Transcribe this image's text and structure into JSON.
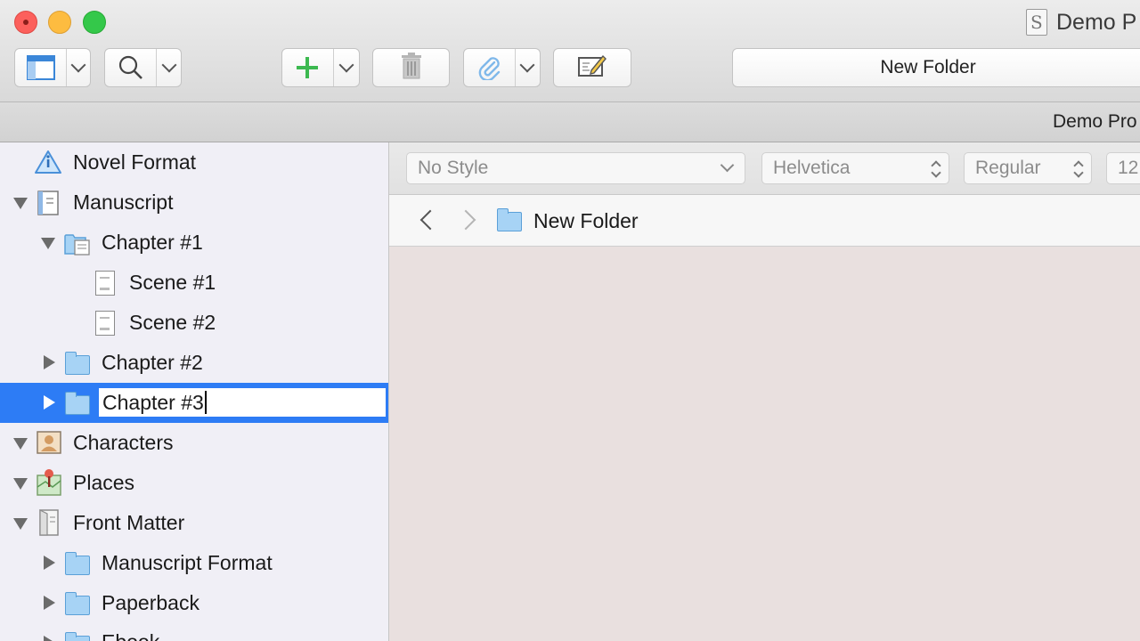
{
  "window": {
    "title": "Demo P",
    "subheader_title": "Demo Pro"
  },
  "toolbar": {
    "title_field": "New Folder"
  },
  "binder": {
    "items": [
      {
        "label": "Novel Format",
        "icon": "warning-triangle-icon",
        "depth": 0,
        "disclosure": "none"
      },
      {
        "label": "Manuscript",
        "icon": "manuscript-icon",
        "depth": 0,
        "disclosure": "expanded"
      },
      {
        "label": "Chapter #1",
        "icon": "folder-with-docs-icon",
        "depth": 1,
        "disclosure": "expanded"
      },
      {
        "label": "Scene #1",
        "icon": "document-icon",
        "depth": 2,
        "disclosure": "none"
      },
      {
        "label": "Scene #2",
        "icon": "document-icon",
        "depth": 2,
        "disclosure": "none"
      },
      {
        "label": "Chapter #2",
        "icon": "folder-icon",
        "depth": 1,
        "disclosure": "collapsed"
      },
      {
        "label": "Chapter #3",
        "icon": "folder-icon",
        "depth": 1,
        "disclosure": "collapsed",
        "selected": true,
        "editing": true
      },
      {
        "label": "Characters",
        "icon": "characters-icon",
        "depth": 0,
        "disclosure": "expanded"
      },
      {
        "label": "Places",
        "icon": "places-icon",
        "depth": 0,
        "disclosure": "expanded"
      },
      {
        "label": "Front Matter",
        "icon": "front-matter-icon",
        "depth": 0,
        "disclosure": "expanded"
      },
      {
        "label": "Manuscript Format",
        "icon": "folder-icon",
        "depth": 1,
        "disclosure": "collapsed"
      },
      {
        "label": "Paperback",
        "icon": "folder-icon",
        "depth": 1,
        "disclosure": "collapsed"
      },
      {
        "label": "Ebook",
        "icon": "folder-icon",
        "depth": 1,
        "disclosure": "collapsed"
      }
    ]
  },
  "format_bar": {
    "style": "No Style",
    "font": "Helvetica",
    "weight": "Regular",
    "size": "12"
  },
  "editor_header": {
    "title": "New Folder"
  },
  "colors": {
    "selection": "#2d7cf5",
    "editor_background": "#e9e0df",
    "binder_background": "#f0eff6",
    "folder_fill": "#a7d3f5"
  }
}
